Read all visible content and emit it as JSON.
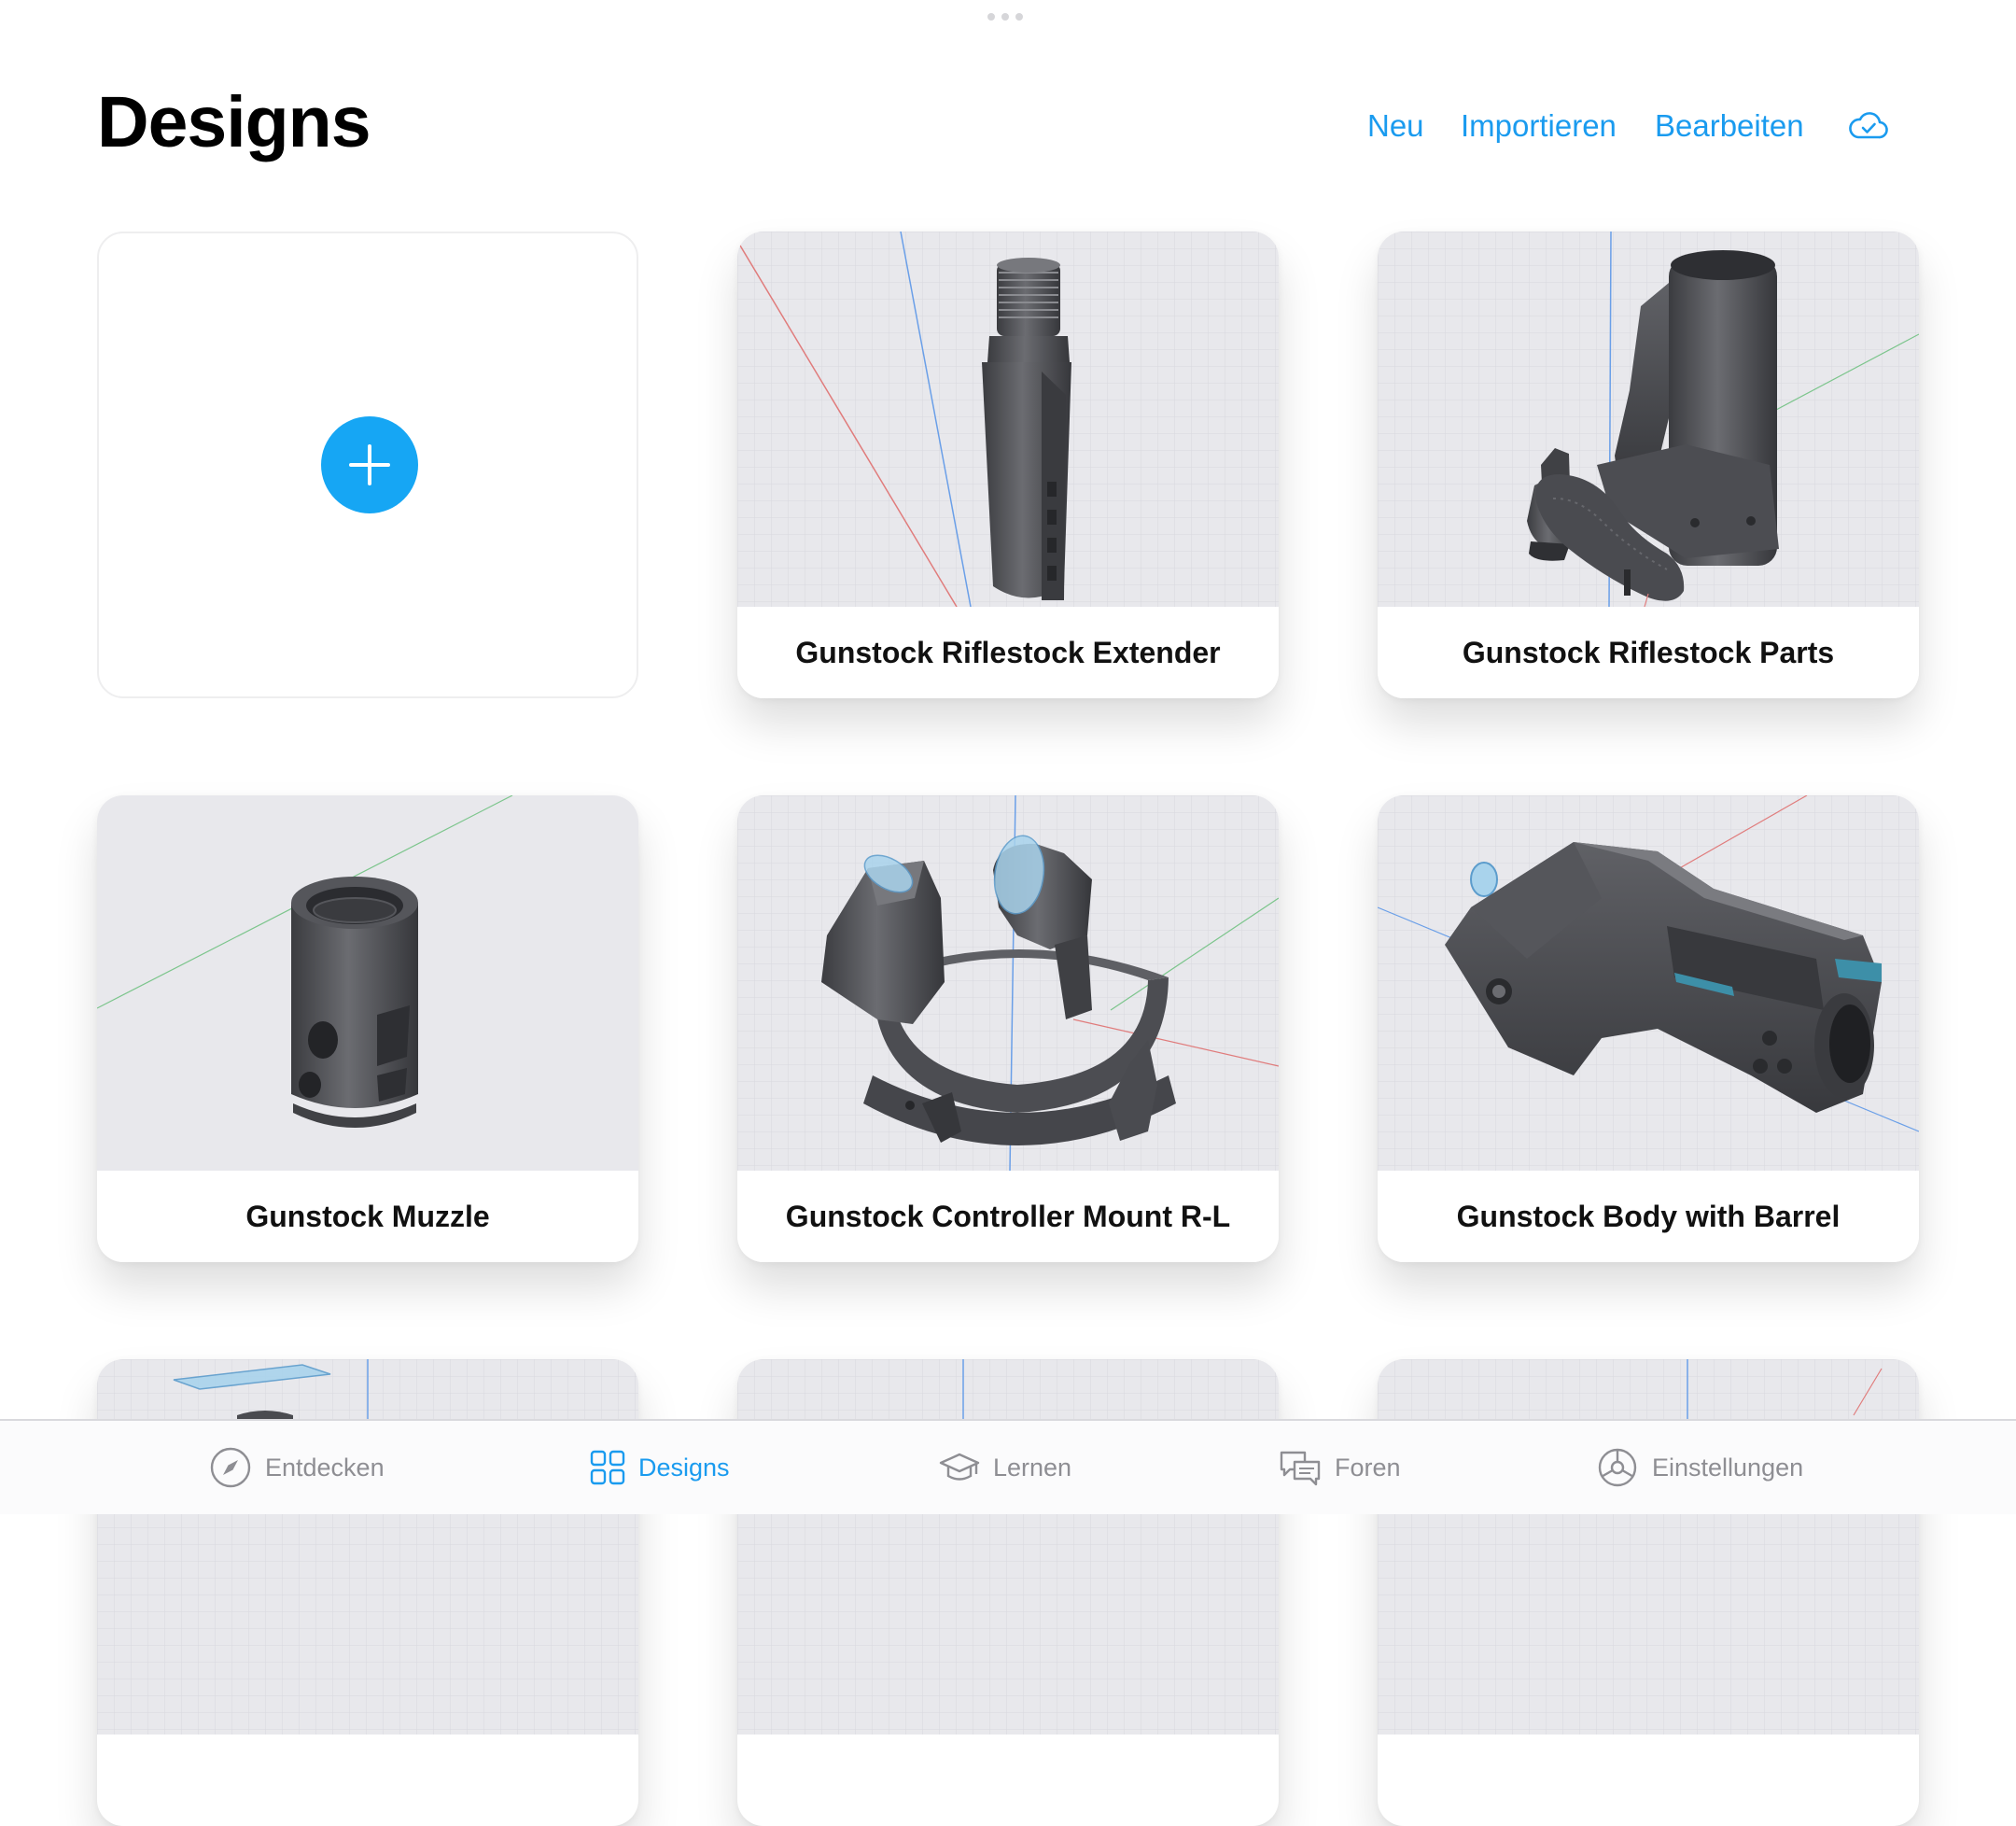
{
  "header": {
    "title": "Designs",
    "actions": {
      "new": "Neu",
      "import": "Importieren",
      "edit": "Bearbeiten"
    },
    "cloud_icon": "cloud-check-icon"
  },
  "new_design": {
    "icon": "plus-icon"
  },
  "designs": [
    {
      "name": "Gunstock Riflestock Extender"
    },
    {
      "name": "Gunstock Riflestock Parts"
    },
    {
      "name": "Gunstock Muzzle"
    },
    {
      "name": "Gunstock Controller Mount R-L"
    },
    {
      "name": "Gunstock Body with Barrel"
    }
  ],
  "tabs": [
    {
      "label": "Entdecken",
      "icon": "compass-icon",
      "active": false
    },
    {
      "label": "Designs",
      "icon": "grid-icon",
      "active": true
    },
    {
      "label": "Lernen",
      "icon": "graduation-cap-icon",
      "active": false
    },
    {
      "label": "Foren",
      "icon": "chat-bubbles-icon",
      "active": false
    },
    {
      "label": "Einstellungen",
      "icon": "gear-icon",
      "active": false
    }
  ],
  "colors": {
    "accent": "#1a9bef",
    "plus_button": "#16a6f4",
    "tab_inactive": "#8e8e93",
    "model_gray": "#4a4b50",
    "viewport_bg": "#e8e8ec"
  }
}
